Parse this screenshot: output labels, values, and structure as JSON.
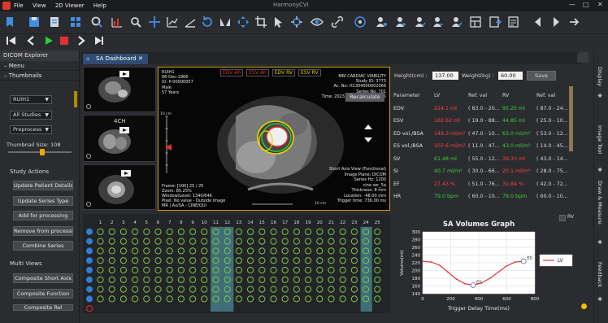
{
  "app": {
    "title": "HarmonyCVI",
    "menu": [
      "File",
      "View",
      "2D Viewer",
      "Help"
    ]
  },
  "colors": {
    "accent_tab": "#2f4d73",
    "viewer_border": "#c8a000",
    "lv_green": "#37d337",
    "rv_red": "#ff4040",
    "graph_line": "#e0393c"
  },
  "left_panel": {
    "title": "DICOM Explorer",
    "sections": {
      "menu": "Menu",
      "thumbnails": "Thumbnails"
    },
    "selects": {
      "patient": "RUIH1",
      "studies": "All Studies",
      "preprocess": "Preprocess"
    },
    "thumbnail_size_label": "Thumbnail Size: 108",
    "thumbnail_size_value": 108,
    "study_actions_header": "Study Actions",
    "study_actions": [
      "Update Patient Details",
      "Update Series Type",
      "Add for processing",
      "Remove from processi",
      "Combine Series"
    ],
    "multi_views_header": "Multi Views",
    "multi_views": [
      "Composite Short Axis",
      "Composite Function",
      "Composite Rel"
    ]
  },
  "tab": {
    "label": "SA Dashboard"
  },
  "thumbnails": [
    {
      "label": ""
    },
    {
      "label": "4CH"
    },
    {
      "label": ""
    }
  ],
  "viewer": {
    "legend": [
      "EDV Ah",
      "ESV Ah",
      "EDV RV",
      "ESV RV"
    ],
    "info_tl": [
      "RUIH1",
      "06-Dec-1966",
      "ID: P-00000057",
      "Male",
      "57 Years"
    ],
    "info_tr": [
      "MRI CARDIAC VIABILITY",
      "Study ID: 3773",
      "Ac. No: H1304000002066",
      "Series No: 701",
      "Time: 2023.12.06 15:42:25.895"
    ],
    "recalculate": "Recalculate",
    "info_bl": [
      "Frame: [100] 25 / 25",
      "Zoom: 85.25%",
      "Window/Level: 1340/646",
      "Pixel: No value - Outside image",
      "MR | Ax/SA - CINE/QUI"
    ],
    "info_br": [
      "Short Axis View (Functional)",
      "Image Plane: DICOM",
      "Series Hz: 1200",
      "cine ser_5a",
      "Thickness: 8 mm",
      "Location: -48.00 mm",
      "Trigger time: 736.00 ms"
    ],
    "scale_left": "10 cm",
    "scale_bottom": "10 cm"
  },
  "results": {
    "height_label": "Height(cm) :",
    "height_value": "137.00",
    "weight_label": "Weight(kg) :",
    "weight_value": "60.00",
    "save": "Save",
    "headers": [
      "Parameter",
      "LV",
      "Ref. val",
      "RV",
      "Ref. val"
    ],
    "rows": [
      {
        "param": "EDV",
        "lv": "224.1 ml",
        "lv_color": "#ff4040",
        "lv_ref": "( 83.0 - 20...",
        "rv": "95.25 ml",
        "rv_color": "#37d337",
        "rv_ref": "( 87.0 - 24..."
      },
      {
        "param": "ESV",
        "lv": "162.62 ml",
        "lv_color": "#ff4040",
        "lv_ref": "( 19.0 - 88...",
        "rv": "44.85 ml",
        "rv_color": "#37d337",
        "rv_ref": "( 25.0 - 10..."
      },
      {
        "param": "ED vol./BSA",
        "lv": "149.3 ml/m²",
        "lv_color": "#ff4040",
        "lv_ref": "( 47.0 - 10...",
        "rv": "63.0 ml/m²",
        "rv_color": "#37d337",
        "rv_ref": "( 53.0 - 12..."
      },
      {
        "param": "ES vol./BSA",
        "lv": "107.6 ml/m²",
        "lv_color": "#ff4040",
        "lv_ref": "( 11.0 - 47...",
        "rv": "43.0 ml/m²",
        "rv_color": "#37d337",
        "rv_ref": "( 14.0 - 45..."
      },
      {
        "param": "SV",
        "lv": "61.48 ml",
        "lv_color": "#37d337",
        "lv_ref": "( 55.0 - 12...",
        "rv": "39.33 ml",
        "rv_color": "#ff4040",
        "rv_ref": "( 43.0 - 14..."
      },
      {
        "param": "SI",
        "lv": "40.7 ml/m²",
        "lv_color": "#37d337",
        "lv_ref": "( 30.0 - 66...",
        "rv": "20.1 ml/m²",
        "rv_color": "#ff4040",
        "rv_ref": "( 28.0 - 75..."
      },
      {
        "param": "EF",
        "lv": "27.43 %",
        "lv_color": "#ff4040",
        "lv_ref": "( 51.0 - 76...",
        "rv": "31.84 %",
        "rv_color": "#ff4040",
        "rv_ref": "( 42.0 - 72..."
      },
      {
        "param": "HR",
        "lv": "79.0 bpm",
        "lv_color": "#37d337",
        "lv_ref": "( 60.0 - 10...",
        "rv": "79.0 bpm",
        "rv_color": "#37d337",
        "rv_ref": "( 60.0 - 10..."
      }
    ]
  },
  "grid": {
    "columns": [
      "1",
      "2",
      "3",
      "4",
      "5",
      "6",
      "7",
      "8",
      "9",
      "10",
      "11",
      "12",
      "13",
      "14",
      "15",
      "16",
      "17",
      "18",
      "19",
      "20",
      "21",
      "22",
      "23",
      "24",
      "25"
    ],
    "rows": 9,
    "active_columns": [
      11,
      12,
      24
    ],
    "ring_color": "#7cc54a"
  },
  "graph": {
    "rv_checkbox": "RV"
  },
  "chart_data": {
    "type": "line",
    "title": "SA Volumes Graph",
    "xlabel": "Trigger Delay Time(ms)",
    "ylabel": "Volume(ml)",
    "xlim": [
      0,
      800
    ],
    "ylim": [
      140,
      300
    ],
    "xticks": [
      0,
      200,
      400,
      600,
      800
    ],
    "yticks": [
      140,
      160,
      180,
      200,
      220,
      240,
      260,
      280,
      300
    ],
    "series": [
      {
        "name": "LV",
        "x": [
          0,
          60,
          120,
          180,
          240,
          300,
          360,
          420,
          480,
          540,
          600,
          660,
          720
        ],
        "y": [
          224,
          222,
          214,
          196,
          178,
          166,
          162,
          168,
          180,
          196,
          212,
          222,
          224
        ]
      }
    ],
    "markers": [
      {
        "x": 360,
        "y": 162,
        "label": "ES"
      },
      {
        "x": 720,
        "y": 224,
        "label": "ED"
      }
    ],
    "grid": true,
    "legend": "right"
  },
  "right_panel": {
    "tabs": [
      "Display",
      "Image Tool",
      "Draw & Measure",
      "Feedback"
    ]
  }
}
